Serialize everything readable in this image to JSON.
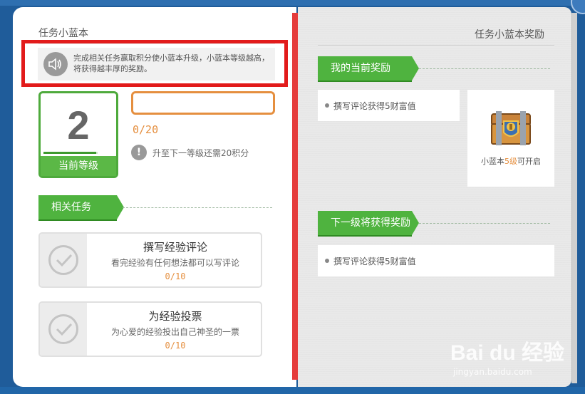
{
  "left_page": {
    "title": "任务小蓝本",
    "notice": "完成相关任务赢取积分使小蓝本升级，小蓝本等级越高，将获得越丰厚的奖励。",
    "level": {
      "value": "2",
      "label": "当前等级"
    },
    "progress": {
      "text": "0/20",
      "hint": "升至下一等级还需20积分"
    },
    "tasks_ribbon": "相关任务",
    "tasks": [
      {
        "title": "撰写经验评论",
        "desc": "看完经验有任何想法都可以写评论",
        "progress": "0/10"
      },
      {
        "title": "为经验投票",
        "desc": "为心爱的经验投出自己神圣的一票",
        "progress": "0/10"
      }
    ]
  },
  "right_page": {
    "title": "任务小蓝本奖励",
    "current_ribbon": "我的当前奖励",
    "current_reward": "撰写评论获得5财富值",
    "chest_label_prefix": "小蓝本",
    "chest_label_level": "5级",
    "chest_label_suffix": "可开启",
    "next_ribbon": "下一级将获得奖励",
    "next_reward": "撰写评论获得5财富值"
  },
  "watermark": {
    "text": "Bai du 经验",
    "url_text": "jingyan.baidu.com"
  },
  "colors": {
    "accent_green": "#4fb33f",
    "progress_orange": "#e58f3f",
    "highlight_red": "#e21b1b",
    "frame_blue": "#1f5c9a"
  }
}
